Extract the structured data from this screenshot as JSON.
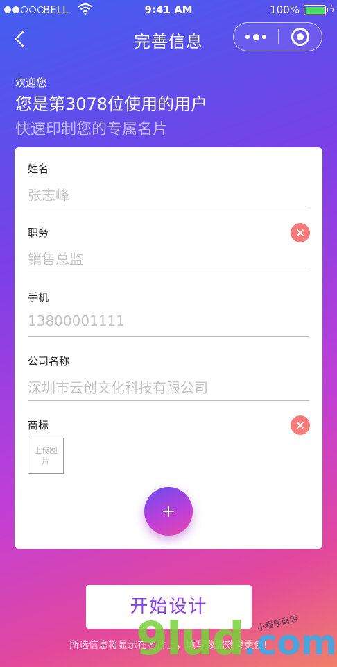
{
  "status_bar": {
    "carrier": "BELL",
    "time": "9:41 AM",
    "battery_percent": "100%",
    "battery_level": 1.0,
    "signal_bars_filled": 2,
    "signal_bars_total": 5
  },
  "nav": {
    "title": "完善信息",
    "back_icon": "chevron-left-icon",
    "more_icon": "more-dots-icon",
    "close_icon": "target-circle-icon"
  },
  "intro": {
    "welcome": "欢迎您",
    "headline": "您是第3078位使用的用户",
    "subline": "快速印制您的专属名片"
  },
  "form": {
    "fields": [
      {
        "label": "姓名",
        "placeholder": "张志峰"
      },
      {
        "label": "职务",
        "placeholder": "销售总监"
      },
      {
        "label": "手机",
        "placeholder": "13800001111"
      },
      {
        "label": "公司名称",
        "placeholder": "深圳市云创文化科技有限公司"
      }
    ],
    "logo_label": "商标",
    "upload_text": "上传图片",
    "add_icon": "plus-icon",
    "clear_icon": "close-circle-icon"
  },
  "actions": {
    "start_label": "开始设计",
    "note": "所选信息将显示在名片上，填写数据效果更佳!"
  },
  "watermark": {
    "main": "9lud",
    "suffix": ".com",
    "sub": "小程序商店"
  },
  "colors": {
    "accent": "#8a3fe8",
    "clear_button": "#f77b7b",
    "battery": "#4cd964"
  }
}
